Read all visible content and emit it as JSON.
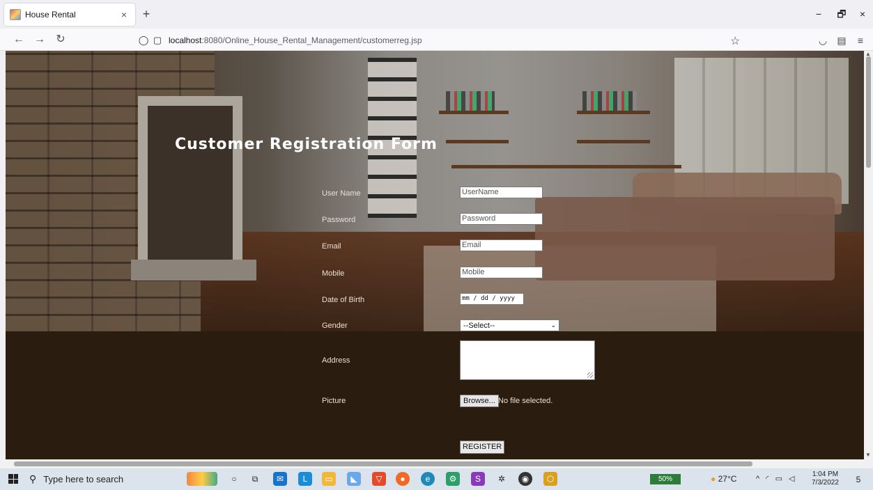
{
  "browser": {
    "tab_title": "House Rental",
    "tab_close": "×",
    "new_tab": "+",
    "url_host": "localhost",
    "url_path": ":8080/Online_House_Rental_Management/customerreg.jsp",
    "window_controls": {
      "minimize": "−",
      "restore": "🗗",
      "close": "×"
    }
  },
  "form": {
    "title": "Customer Registration Form",
    "fields": [
      {
        "label": "User Name",
        "placeholder": "UserName"
      },
      {
        "label": "Password",
        "placeholder": "Password"
      },
      {
        "label": "Email",
        "placeholder": "Email"
      },
      {
        "label": "Mobile",
        "placeholder": "Mobile"
      },
      {
        "label": "Date of Birth",
        "value": "mm / dd / yyyy"
      },
      {
        "label": "Gender",
        "value": "--Select--"
      },
      {
        "label": "Address",
        "value": ""
      },
      {
        "label": "Picture",
        "button": "Browse...",
        "status": "No file selected."
      }
    ],
    "submit_label": "REGISTER"
  },
  "taskbar": {
    "search_placeholder": "Type here to search",
    "battery": "50%",
    "weather": "27°C",
    "time": "1:04 PM",
    "date": "7/3/2022",
    "notification_count": "5"
  },
  "colors": {
    "page_background": "#2a1c0e",
    "title_text": "#ffffff",
    "label_text": "#e8e0d6"
  }
}
